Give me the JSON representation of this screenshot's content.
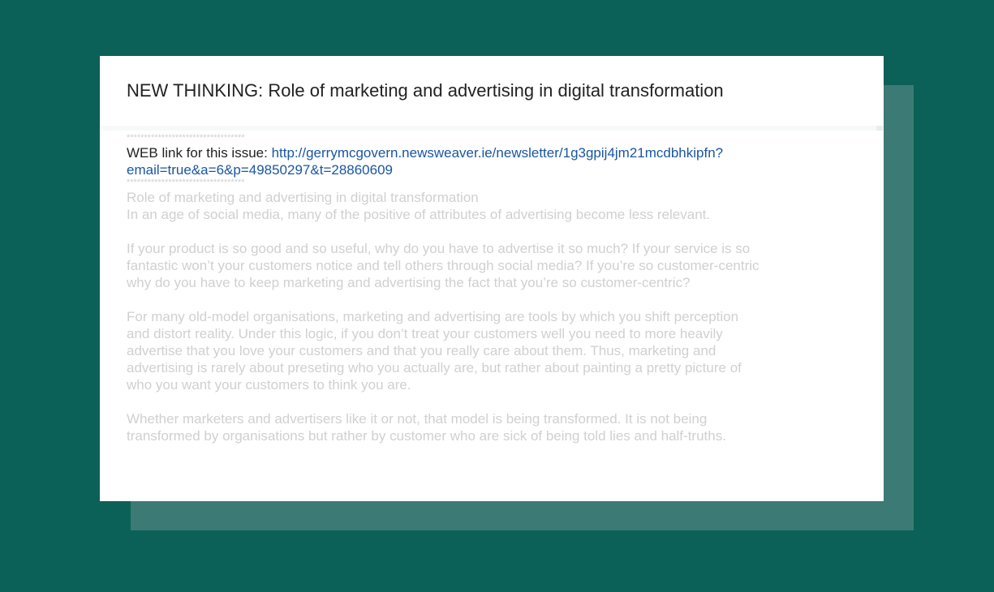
{
  "email": {
    "subject": "NEW THINKING: Role of marketing and advertising in digital transformation",
    "separator": "**********************************",
    "web_link_label": "WEB link for this issue: ",
    "web_link_line1": "http://gerrymcgovern.newsweaver.ie/newsletter/1g3gpij4jm21mcdbhkipfn?",
    "web_link_line2": "email=true&a=6&p=49850297&t=28860609",
    "article_title": "Role of marketing and advertising in digital transformation",
    "intro": "In an age of social media, many of the positive of attributes of advertising become less relevant.",
    "paragraphs": [
      [
        "If your product is so good and so useful, why do you have to advertise it so much? If your service is so",
        "fantastic won’t your customers notice and tell others through social media? If you’re so customer-centric",
        "why do you have to keep marketing and advertising the fact that you’re so customer-centric?"
      ],
      [
        "For many old-model organisations, marketing and advertising are tools by which you shift perception",
        "and distort reality. Under this logic, if you don’t treat your customers well you need to more heavily",
        "advertise that you love your customers and that you really care about them. Thus, marketing and",
        "advertising is rarely about preseting who you actually are, but rather about painting a pretty picture of",
        "who you want your customers to think you are."
      ],
      [
        "Whether marketers and advertisers like it or not, that model is being transformed. It is not being",
        "transformed by organisations but rather by customer who are sick of being told lies and half-truths."
      ]
    ]
  },
  "colors": {
    "background": "#0b6157",
    "shadow_panel": "#3c7b75",
    "card": "#ffffff",
    "link": "#1a56a3",
    "faded_text": "#d0d0d0"
  }
}
